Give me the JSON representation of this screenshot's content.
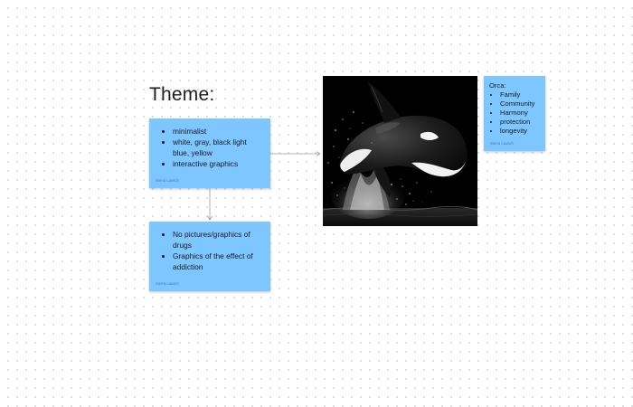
{
  "board": {
    "title": "Theme:"
  },
  "notes": {
    "theme": {
      "items": [
        "minimalist",
        "white, gray, black light blue, yellow",
        "interactive graphics"
      ],
      "author": "Sierra Lausch"
    },
    "rules": {
      "items": [
        "No pictures/graphics of drugs",
        "Graphics of the effect of addiction"
      ],
      "author": "Sierra Lausch"
    },
    "orca": {
      "heading": "Orca:",
      "items": [
        "Family",
        "Community",
        "Harmony",
        "protection",
        "longevity"
      ],
      "author": "Sierra Lausch"
    }
  },
  "image": {
    "subject": "orca-leaping-photo"
  },
  "colors": {
    "sticky": "#7ec6ff",
    "canvas_dot": "#d6d6d6",
    "connector": "#9e9e9e"
  }
}
